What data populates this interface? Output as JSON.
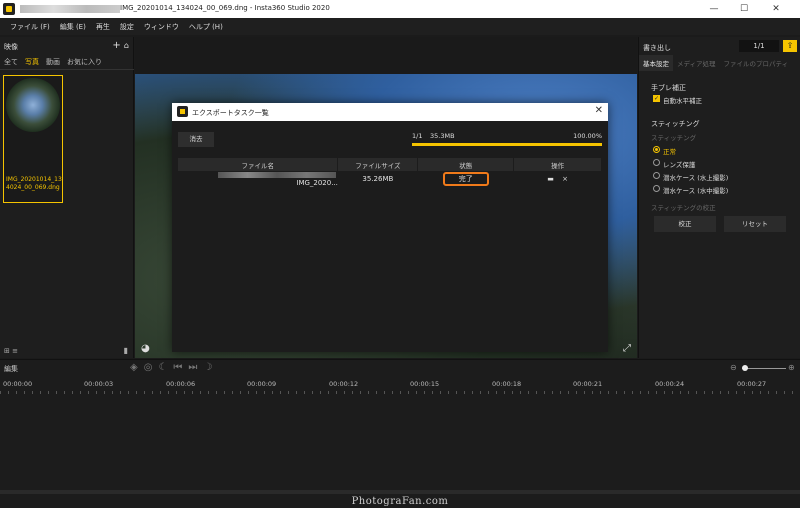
{
  "window": {
    "title": "IMG_20201014_134024_00_069.dng - Insta360 Studio 2020",
    "controls": [
      "—",
      "☐",
      "✕"
    ]
  },
  "menu": [
    "ファイル (F)",
    "編集 (E)",
    "再生",
    "設定",
    "ウィンドウ",
    "ヘルプ (H)"
  ],
  "media_panel": {
    "title": "映像",
    "tabs": [
      "全て",
      "写真",
      "動画",
      "お気に入り"
    ],
    "active_tab": "写真",
    "thumbnail_caption": "IMG_20201014_134024_00_069.dng"
  },
  "right_panel": {
    "title": "書き出し",
    "counter": "1/1",
    "tabs": [
      "基本設定",
      "メディア処理",
      "ファイルのプロパティ"
    ],
    "stabilization": {
      "title": "手ブレ補正",
      "checkbox_label": "自動水平補正"
    },
    "stitching": {
      "title": "スティッチング",
      "subtitle": "スティッチング",
      "options": [
        "正常",
        "レンズ保護",
        "潜水ケース (水上撮影)",
        "潜水ケース (水中撮影)"
      ],
      "selected": "正常",
      "calibration_title": "スティッチングの校正",
      "calibrate_button": "校正",
      "reset_button": "リセット"
    }
  },
  "modal": {
    "title": "エクスポートタスク一覧",
    "clear_button": "消去",
    "progress": {
      "count": "1/1",
      "size": "35.3MB",
      "percent": "100.00%",
      "fraction": 1.0
    },
    "table": {
      "headers": [
        "ファイル名",
        "ファイルサイズ",
        "状態",
        "操作"
      ],
      "rows": [
        {
          "name": "IMG_2020...",
          "size": "35.26MB",
          "status": "完了"
        }
      ]
    }
  },
  "timeline": {
    "title": "編集",
    "ticks": [
      "00:00:00",
      "00:00:03",
      "00:00:06",
      "00:00:09",
      "00:00:12",
      "00:00:15",
      "00:00:18",
      "00:00:21",
      "00:00:24",
      "00:00:27"
    ]
  },
  "watermark": "PhotograFan.com"
}
